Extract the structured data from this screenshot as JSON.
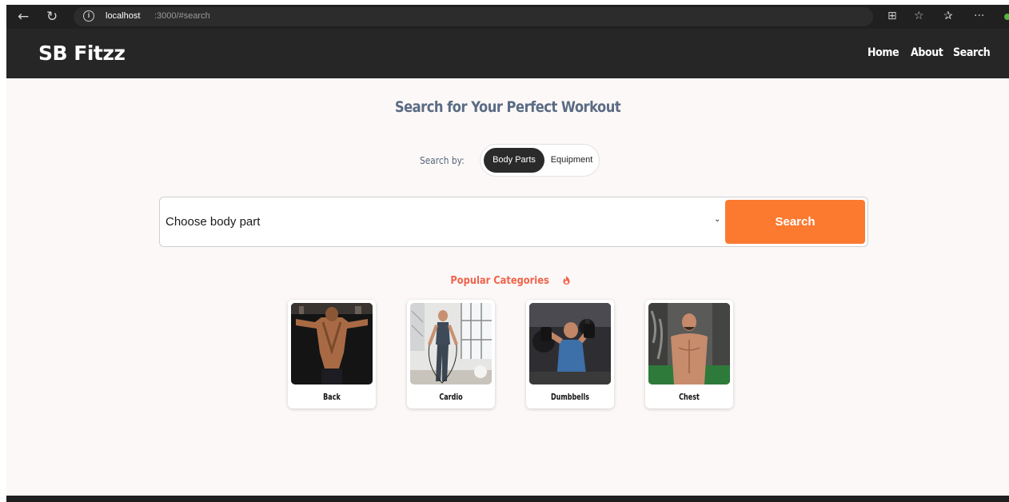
{
  "browser": {
    "url_host": "localhost",
    "url_path": ":3000/#search",
    "icons": [
      "back-arrow-icon",
      "refresh-icon",
      "info-icon",
      "grid-icon",
      "star-icon",
      "favorites-icon",
      "more-icon"
    ]
  },
  "header": {
    "logo": "SB Fitzz",
    "nav": [
      "Home",
      "About",
      "Search"
    ]
  },
  "main": {
    "title": "Search for Your Perfect Workout",
    "search_by_label": "Search by:",
    "toggle": {
      "options": [
        "Body Parts",
        "Equipment"
      ],
      "active": "Body Parts"
    },
    "select_value": "Choose body part",
    "search_button": "Search",
    "popular_title": "Popular Categories",
    "categories": [
      "Back",
      "Cardio",
      "Dumbbells",
      "Chest"
    ]
  },
  "colors": {
    "accent": "#fb7a30",
    "popular_title": "#f0634a",
    "header_bg": "#262626",
    "page_bg": "#fcf8f7",
    "title": "#5a6b84"
  }
}
